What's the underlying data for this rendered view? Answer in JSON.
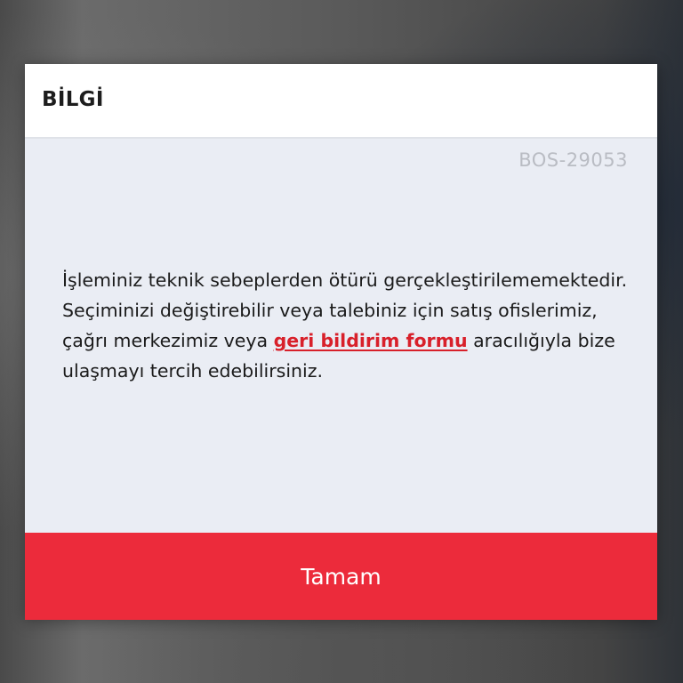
{
  "dialog": {
    "title": "BİLGİ",
    "error_code": "BOS-29053",
    "message_before_link": "İşleminiz teknik sebeplerden ötürü gerçekleştirilememektedir. Seçiminizi değiştirebilir veya talebiniz için satış ofislerimiz, çağrı merkezimiz veya ",
    "link_text": "geri bildirim formu",
    "message_after_link": " aracılığıyla bize ulaşmayı tercih edebilirsiniz.",
    "ok_label": "Tamam"
  },
  "colors": {
    "accent": "#ec2b3b",
    "link": "#d8202a",
    "dialog_body": "#eaedf4",
    "header_bg": "#ffffff",
    "code_text": "#b9bcc3"
  }
}
